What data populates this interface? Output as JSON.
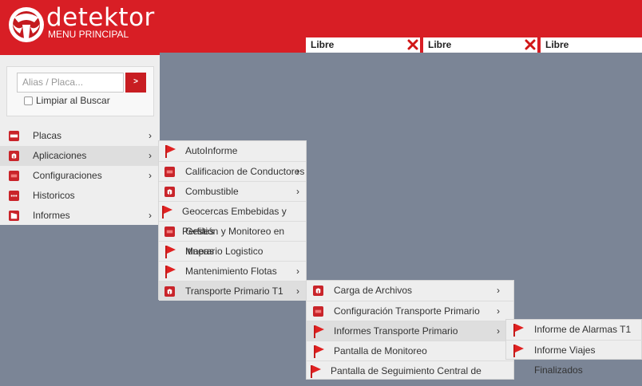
{
  "header": {
    "brand": "detektor",
    "subtitle": "MENU PRINCIPAL",
    "logo_icon": "detektor-logo-icon",
    "brand_color": "#d81e25"
  },
  "tabs": [
    {
      "label": "Libre",
      "close_icon": "close-icon"
    },
    {
      "label": "Libre",
      "close_icon": "close-icon"
    },
    {
      "label": "Libre",
      "close_icon": "close-icon"
    }
  ],
  "search": {
    "placeholder": "Alias / Placa...",
    "button_label": ">",
    "clear_label": "Limpiar al Buscar",
    "clear_checked": false
  },
  "main_menu": [
    {
      "label": "Placas",
      "icon": "plates-icon",
      "arrow": "›"
    },
    {
      "label": "Aplicaciones",
      "icon": "applications-icon",
      "arrow": "›"
    },
    {
      "label": "Configuraciones",
      "icon": "settings-icon",
      "arrow": "›"
    },
    {
      "label": "Historicos",
      "icon": "history-icon",
      "arrow": ""
    },
    {
      "label": "Informes",
      "icon": "reports-icon",
      "arrow": "›"
    }
  ],
  "apps_menu": [
    {
      "label": "AutoInforme",
      "icon": "flag-icon",
      "arrow": ""
    },
    {
      "label": "Calificacion de Conductores",
      "icon": "driver-rating-icon",
      "arrow": "›"
    },
    {
      "label": "Combustible",
      "icon": "fuel-icon",
      "arrow": "›"
    },
    {
      "label": "Geocercas Embebidas y Perfiles",
      "icon": "flag-icon",
      "arrow": ""
    },
    {
      "label": "Gestión y Monitoreo en Mapas",
      "icon": "map-icon",
      "arrow": ""
    },
    {
      "label": "Itinerario Logistico",
      "icon": "flag-icon",
      "arrow": ""
    },
    {
      "label": "Mantenimiento Flotas",
      "icon": "flag-icon",
      "arrow": "›"
    },
    {
      "label": "Transporte Primario T1",
      "icon": "box-icon",
      "arrow": "›"
    }
  ],
  "tp_menu": [
    {
      "label": "Carga de Archivos",
      "icon": "box-icon",
      "arrow": "›"
    },
    {
      "label": "Configuración Transporte Primario",
      "icon": "settings-icon",
      "arrow": "›"
    },
    {
      "label": "Informes Transporte Primario",
      "icon": "flag-icon",
      "arrow": "›"
    },
    {
      "label": "Pantalla de Monitoreo",
      "icon": "flag-icon",
      "arrow": ""
    },
    {
      "label": "Pantalla de Seguimiento Central de Monitoreo",
      "icon": "flag-icon",
      "arrow": ""
    }
  ],
  "informes_menu": [
    {
      "label": "Informe de Alarmas T1",
      "icon": "flag-icon"
    },
    {
      "label": "Informe Viajes Finalizados",
      "icon": "flag-icon"
    }
  ]
}
